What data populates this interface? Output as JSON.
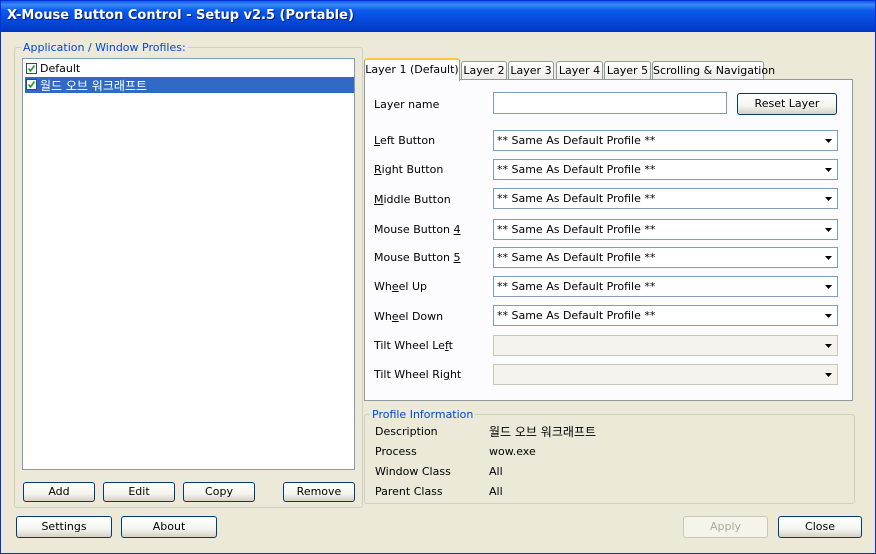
{
  "window": {
    "title": "X-Mouse Button Control - Setup v2.5 (Portable)"
  },
  "profiles": {
    "group_label": "Application / Window Profiles:",
    "items": [
      {
        "label": "Default",
        "checked": true,
        "selected": false
      },
      {
        "label": "월드 오브 워크래프트",
        "checked": true,
        "selected": true
      }
    ],
    "buttons": {
      "add": "Add",
      "edit": "Edit",
      "copy": "Copy",
      "remove": "Remove"
    }
  },
  "tabs": [
    {
      "label": "Layer 1 (Default)",
      "active": true
    },
    {
      "label": "Layer 2",
      "active": false
    },
    {
      "label": "Layer 3",
      "active": false
    },
    {
      "label": "Layer 4",
      "active": false
    },
    {
      "label": "Layer 5",
      "active": false
    },
    {
      "label": "Scrolling & Navigation",
      "active": false
    }
  ],
  "layer": {
    "name_label": "Layer name",
    "name_value": "",
    "reset_button": "Reset Layer",
    "rows": [
      {
        "label": "Left Button",
        "value": "** Same As Default Profile **",
        "enabled": true
      },
      {
        "label": "Right Button",
        "value": "** Same As Default Profile **",
        "enabled": true
      },
      {
        "label": "Middle Button",
        "value": "** Same As Default Profile **",
        "enabled": true
      },
      {
        "label": "Mouse Button 4",
        "value": "** Same As Default Profile **",
        "enabled": true
      },
      {
        "label": "Mouse Button 5",
        "value": "** Same As Default Profile **",
        "enabled": true
      },
      {
        "label": "Wheel Up",
        "value": "** Same As Default Profile **",
        "enabled": true
      },
      {
        "label": "Wheel Down",
        "value": "** Same As Default Profile **",
        "enabled": true
      },
      {
        "label": "Tilt Wheel Left",
        "value": "",
        "enabled": false
      },
      {
        "label": "Tilt Wheel Right",
        "value": "",
        "enabled": false
      }
    ]
  },
  "profile_info": {
    "group_label": "Profile Information",
    "rows": [
      {
        "label": "Description",
        "value": "월드 오브 워크래프트"
      },
      {
        "label": "Process",
        "value": "wow.exe"
      },
      {
        "label": "Window Class",
        "value": "All"
      },
      {
        "label": "Parent Class",
        "value": "All"
      }
    ]
  },
  "footer": {
    "settings": "Settings",
    "about": "About",
    "apply": "Apply",
    "close": "Close"
  },
  "colors": {
    "titlebar": "#0A5BEB",
    "group_label": "#0046D5",
    "selection": "#316AC5",
    "face": "#ECE9D8"
  }
}
